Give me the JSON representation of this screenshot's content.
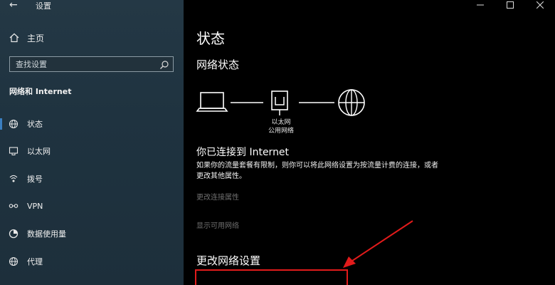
{
  "window": {
    "app_title": "设置"
  },
  "sidebar": {
    "home_label": "主页",
    "search_placeholder": "查找设置",
    "section_title": "网络和 Internet",
    "items": [
      {
        "label": "状态",
        "icon": "globe-icon"
      },
      {
        "label": "以太网",
        "icon": "ethernet-icon"
      },
      {
        "label": "拨号",
        "icon": "dialup-icon"
      },
      {
        "label": "VPN",
        "icon": "vpn-icon"
      },
      {
        "label": "数据使用量",
        "icon": "data-usage-icon"
      },
      {
        "label": "代理",
        "icon": "globe-icon"
      }
    ]
  },
  "main": {
    "title": "状态",
    "network_status_heading": "网络状态",
    "connection_label_line1": "以太网",
    "connection_label_line2": "公用网络",
    "connected_text": "你已连接到 Internet",
    "description": "如果你的流量套餐有限制，则你可以将此网络设置为按流量计费的连接，或者更改其他属性。",
    "link_change_properties": "更改连接属性",
    "link_show_networks": "显示可用网络",
    "change_settings_heading": "更改网络设置"
  },
  "colors": {
    "sidebar_bg": "#1f3340",
    "main_bg": "#000000",
    "accent": "#3a7fc1",
    "annotation_red": "#e21b1b"
  }
}
